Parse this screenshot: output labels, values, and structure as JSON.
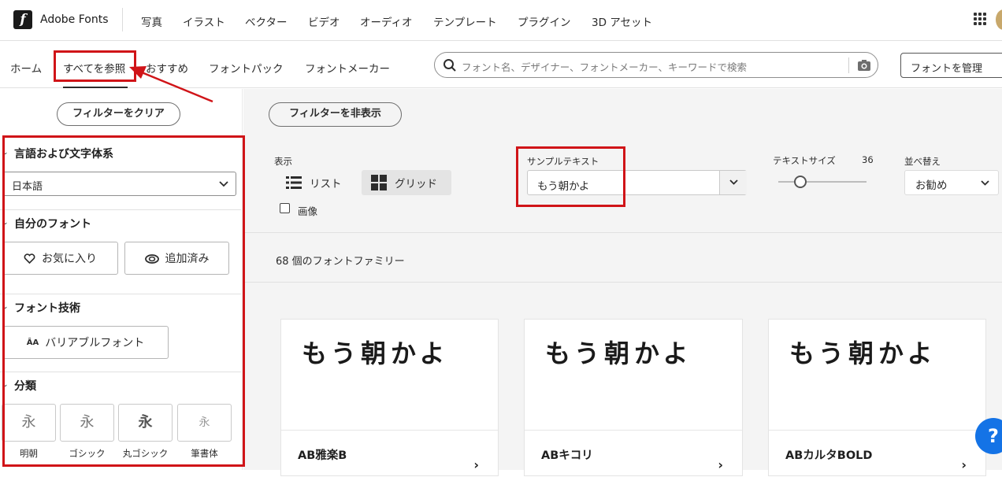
{
  "header": {
    "logo_letter": "f",
    "brand": "Adobe Fonts",
    "nav": [
      "写真",
      "イラスト",
      "ベクター",
      "ビデオ",
      "オーディオ",
      "テンプレート",
      "プラグイン",
      "3D アセット"
    ]
  },
  "subnav": {
    "items": [
      "ホーム",
      "すべてを参照",
      "おすすめ",
      "フォントパック",
      "フォントメーカー"
    ],
    "active_index": 1,
    "search_placeholder": "フォント名、デザイナー、フォントメーカー、キーワードで検索",
    "manage_label": "フォントを管理"
  },
  "sidebar": {
    "clear_filters": "フィルターをクリア",
    "language_title": "言語および文字体系",
    "language_value": "日本語",
    "my_fonts_title": "自分のフォント",
    "favorites_label": "お気に入り",
    "added_label": "追加済み",
    "tech_title": "フォント技術",
    "variable_label": "バリアブルフォント",
    "variable_icon_text": "ÂA",
    "classification_title": "分類",
    "classifications": [
      {
        "glyph": "永",
        "label": "明朝"
      },
      {
        "glyph": "永",
        "label": "ゴシック"
      },
      {
        "glyph": "永",
        "label": "丸ゴシック"
      },
      {
        "glyph": "永",
        "label": "筆書体"
      }
    ]
  },
  "toolbar": {
    "hide_filters": "フィルターを非表示",
    "view_label": "表示",
    "list_label": "リスト",
    "grid_label": "グリッド",
    "image_label": "画像",
    "sample_label": "サンプルテキスト",
    "sample_value": "もう朝かよ",
    "size_label": "テキストサイズ",
    "size_value": "36",
    "sort_label": "並べ替え",
    "sort_value": "お勧め"
  },
  "results": {
    "count_text": "68 個のフォントファミリー",
    "cards": [
      {
        "sample": "もう朝かよ",
        "name": "AB雅楽B"
      },
      {
        "sample": "もう朝かよ",
        "name": "ABキコリ"
      },
      {
        "sample": "もう朝かよ",
        "name": "ABカルタBOLD"
      }
    ]
  },
  "help_icon_text": "?",
  "colors": {
    "annotation_red": "#d01418",
    "help_blue": "#1473e6",
    "main_bg": "#f4f4f4"
  }
}
